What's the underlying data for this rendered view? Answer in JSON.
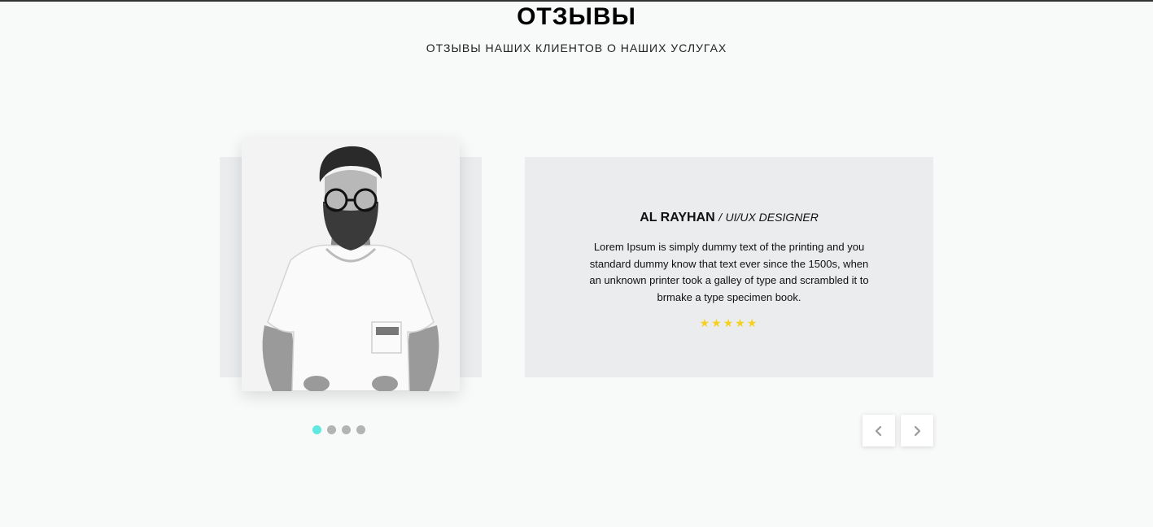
{
  "section": {
    "title": "ОТЗЫВЫ",
    "subtitle": "ОТЗЫВЫ НАШИХ КЛИЕНТОВ О НАШИХ УСЛУГАХ"
  },
  "testimonial": {
    "name": "AL RAYHAN",
    "separator": "/",
    "role": "UI/UX DESIGNER",
    "text": "Lorem Ipsum is simply dummy text of the printing and you standard dummy know that text ever since the 1500s, when an unknown printer took a galley of type and scrambled it to brmake a type specimen book.",
    "rating": 5,
    "star_color": "#f5d020"
  },
  "slider": {
    "dot_count": 4,
    "active_index": 0,
    "active_color": "#5ee8e0",
    "inactive_color": "#b3b3b3"
  },
  "icons": {
    "prev": "chevron-left-icon",
    "next": "chevron-right-icon",
    "star": "star-icon"
  }
}
